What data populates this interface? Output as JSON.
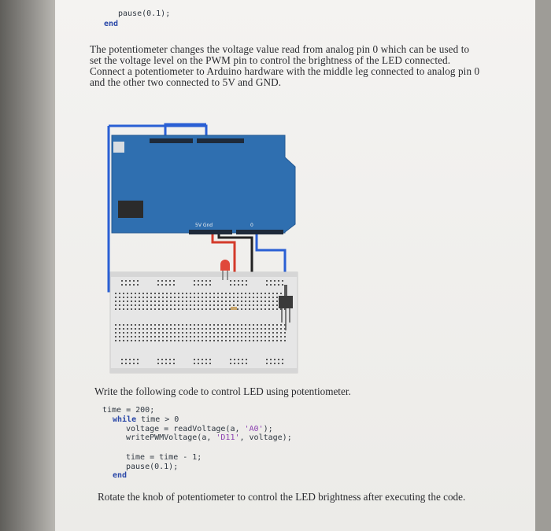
{
  "top_code": {
    "line1": "pause(0.1);",
    "line2": "end"
  },
  "description": "The potentiometer changes the voltage value read from analog pin 0 which can be used to set the voltage level on the PWM pin to control the brightness of the LED connected. Connect a potentiometer to Arduino hardware with the middle leg connected to analog pin 0 and the other two connected to 5V and GND.",
  "figure": {
    "board_labels": {
      "power": "5V Gnd",
      "analog": "0"
    }
  },
  "instruction": "Write the following code to control LED using potentiometer.",
  "code": {
    "l1": "time = 200;",
    "l2_kw": "while",
    "l2_rest": " time > 0",
    "l3_a": "voltage = readVoltage(a, ",
    "l3_str": "'A0'",
    "l3_b": ");",
    "l4_a": "writePWMVoltage(a, ",
    "l4_str": "'D11'",
    "l4_b": ", voltage);",
    "l5": "time = time - 1;",
    "l6": "pause(0.1);",
    "l7": "end"
  },
  "closing": "Rotate the knob of potentiometer to control the LED brightness after executing the code.",
  "colors": {
    "arduino": "#2f6fb0",
    "wire_blue": "#2a5fd4",
    "wire_red": "#d33a2a",
    "wire_black": "#222222",
    "led": "#e0483a",
    "breadboard": "#e6e6e6"
  }
}
